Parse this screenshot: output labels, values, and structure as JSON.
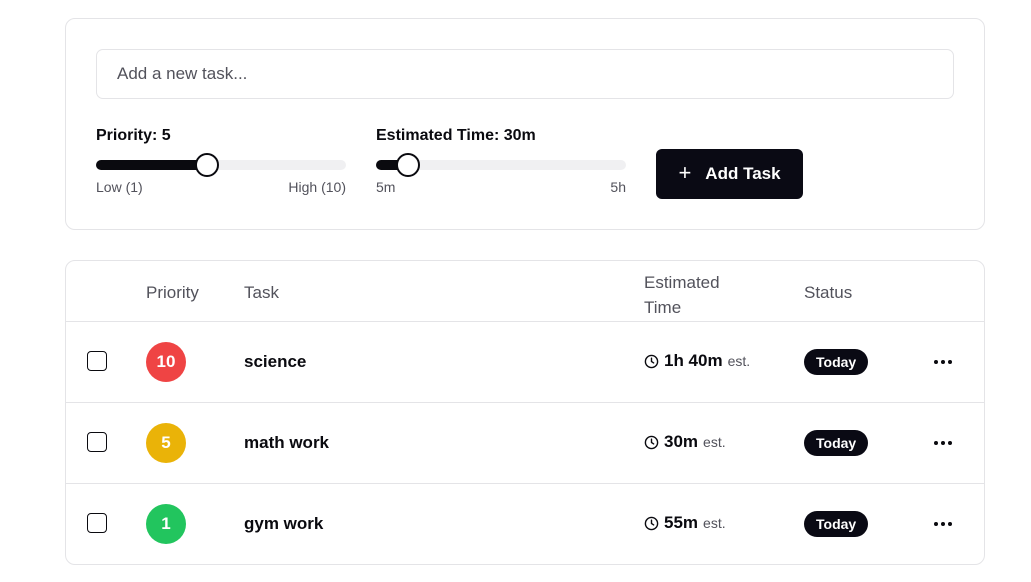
{
  "form": {
    "input_placeholder": "Add a new task...",
    "input_value": "",
    "priority": {
      "label": "Priority: 5",
      "min_label": "Low (1)",
      "max_label": "High (10)",
      "min": 1,
      "max": 10,
      "value": 5
    },
    "estimated_time": {
      "label": "Estimated Time: 30m",
      "min_label": "5m",
      "max_label": "5h",
      "min_minutes": 5,
      "max_minutes": 300,
      "value_minutes": 30
    },
    "add_button_label": "Add Task",
    "add_button_icon": "plus-icon"
  },
  "table": {
    "headers": {
      "priority": "Priority",
      "task": "Task",
      "estimated_time": "Estimated Time",
      "status": "Status"
    },
    "rows": [
      {
        "checked": false,
        "priority": "10",
        "priority_color": "#ef4444",
        "task": "science",
        "time": "1h 40m",
        "time_suffix": "est.",
        "status": "Today"
      },
      {
        "checked": false,
        "priority": "5",
        "priority_color": "#eab308",
        "task": "math work",
        "time": "30m",
        "time_suffix": "est.",
        "status": "Today"
      },
      {
        "checked": false,
        "priority": "1",
        "priority_color": "#22c55e",
        "task": "gym work",
        "time": "55m",
        "time_suffix": "est.",
        "status": "Today"
      }
    ]
  },
  "colors": {
    "primary": "#0a0a14",
    "border": "#e4e4e7",
    "muted_text": "#52525b"
  }
}
